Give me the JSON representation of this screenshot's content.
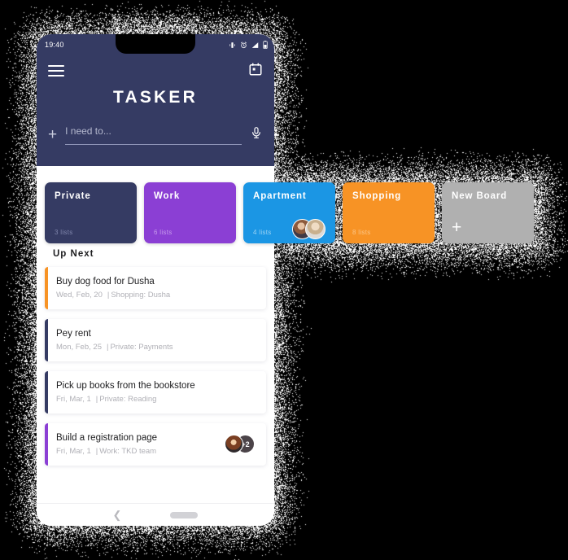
{
  "status_bar": {
    "time": "19:40",
    "icons": [
      "vibrate-icon",
      "alarm-icon",
      "signal-icon",
      "battery-icon"
    ]
  },
  "app_bar": {
    "menu_icon": "hamburger-menu-icon",
    "calendar_icon": "calendar-icon",
    "title": "TASKER"
  },
  "search": {
    "add_label": "+",
    "placeholder": "I need to...",
    "value": "",
    "mic_icon": "microphone-icon"
  },
  "boards": {
    "items": [
      {
        "name": "Private",
        "sub": "3 lists",
        "color": "#353b63",
        "sub_color": "#8187ad",
        "avatars": []
      },
      {
        "name": "Work",
        "sub": "6 lists",
        "color": "#8b3fd4",
        "sub_color": "#c79bec",
        "avatars": []
      },
      {
        "name": "Apartment",
        "sub": "4 lists",
        "color": "#1b96e4",
        "sub_color": "#9bd3f4",
        "avatars": [
          "avatar-photo",
          "avatar-photo"
        ]
      },
      {
        "name": "Shopping",
        "sub": "8 lists",
        "color": "#f79325",
        "sub_color": "#fbc687",
        "avatars": []
      },
      {
        "name": "New Board",
        "sub": "",
        "color": "#b0b0b0",
        "sub_color": "#d8d8d8",
        "avatars": [],
        "add_label": "+"
      }
    ]
  },
  "up_next": {
    "heading": "Up Next",
    "tasks": [
      {
        "title": "Buy dog food for Dusha",
        "date": "Wed, Feb, 20",
        "separator": "|",
        "category": "Shopping: Dusha",
        "accent": "#f79325",
        "avatars": [],
        "extra_count": ""
      },
      {
        "title": "Pey rent",
        "date": "Mon, Feb, 25",
        "separator": "|",
        "category": "Private: Payments",
        "accent": "#353b63",
        "avatars": [],
        "extra_count": ""
      },
      {
        "title": "Pick up books from the bookstore",
        "date": "Fri, Mar, 1",
        "separator": "|",
        "category": "Private: Reading",
        "accent": "#353b63",
        "avatars": [],
        "extra_count": ""
      },
      {
        "title": "Build a registration page",
        "date": "Fri, Mar, 1",
        "separator": "|",
        "category": "Work: TKD team",
        "accent": "#8b3fd4",
        "avatars": [
          "avatar-photo"
        ],
        "extra_count": "+2"
      }
    ]
  },
  "nav_bar": {
    "back_icon": "chevron-left-icon",
    "home_indicator": "home-pill-indicator"
  },
  "theme": {
    "background": "#000000",
    "header_bg": "#353b63",
    "surface": "#ffffff"
  }
}
